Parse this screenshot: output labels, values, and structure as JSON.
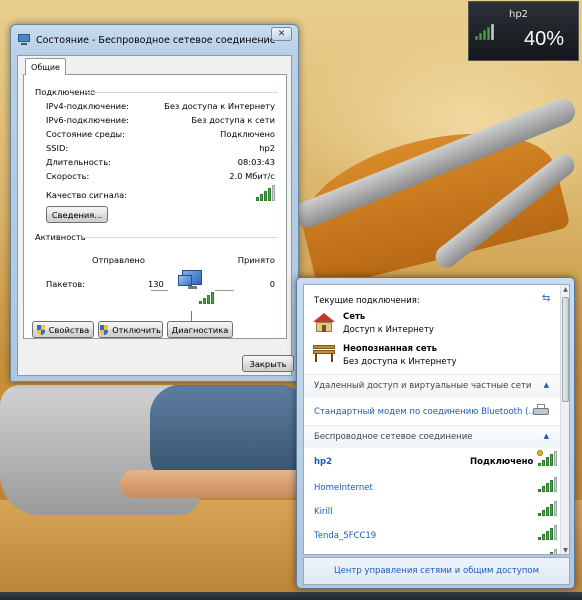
{
  "wifi_tooltip": {
    "network": "hp2",
    "percent": "40%"
  },
  "status_dialog": {
    "title": "Состояние - Беспроводное сетевое соединение",
    "tab": "Общие",
    "connection_group": "Подключение",
    "rows": [
      {
        "label": "IPv4-подключение:",
        "value": "Без доступа к Интернету"
      },
      {
        "label": "IPv6-подключение:",
        "value": "Без доступа к сети"
      },
      {
        "label": "Состояние среды:",
        "value": "Подключено"
      },
      {
        "label": "SSID:",
        "value": "hp2"
      },
      {
        "label": "Длительность:",
        "value": "08:03:43"
      },
      {
        "label": "Скорость:",
        "value": "2.0 Мбит/с"
      }
    ],
    "signal_quality_label": "Качество сигнала:",
    "details_button": "Сведения...",
    "activity_group": "Активность",
    "sent_label": "Отправлено",
    "received_label": "Принято",
    "packets_label": "Пакетов:",
    "packets_sent": "130",
    "packets_received": "0",
    "properties_button": "Свойства",
    "disable_button": "Отключить",
    "diagnose_button": "Диагностика",
    "close_button": "Закрыть"
  },
  "network_flyout": {
    "current_connections_label": "Текущие подключения:",
    "connections": [
      {
        "name": "Сеть",
        "status": "Доступ к Интернету"
      },
      {
        "name": "Неопознанная сеть",
        "status": "Без доступа к Интернету"
      }
    ],
    "dialup_section": "Удаленный доступ и виртуальные частные сети",
    "dialup_item": "Стандартный модем по соединению Bluetooth (...",
    "wireless_section": "Беспроводное сетевое соединение",
    "wireless_networks": [
      {
        "name": "hp2",
        "status": "Подключено"
      },
      {
        "name": "HomeInternet",
        "status": ""
      },
      {
        "name": "Kirill",
        "status": ""
      },
      {
        "name": "Tenda_5FCC19",
        "status": ""
      }
    ],
    "footer_link": "Центр управления сетями и общим доступом"
  }
}
